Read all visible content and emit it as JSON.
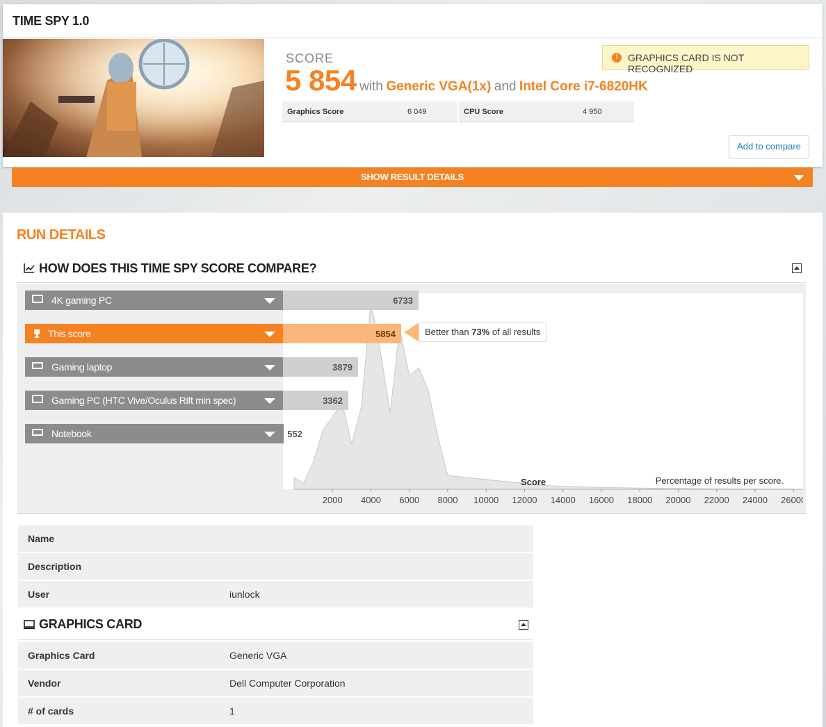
{
  "page": {
    "title": "TIME SPY 1.0"
  },
  "result": {
    "score_label": "SCORE",
    "score_value": "5 854",
    "with_text": "with",
    "gpu": "Generic VGA(1x)",
    "and_text": "and",
    "cpu": "Intel Core i7-6820HK",
    "graphics_score_label": "Graphics Score",
    "graphics_score": "6 049",
    "cpu_score_label": "CPU Score",
    "cpu_score": "4 950",
    "warning": "GRAPHICS CARD IS NOT RECOGNIZED",
    "compare_button": "Add to compare",
    "details_bar": "SHOW RESULT DETAILS"
  },
  "run_details": {
    "title": "RUN DETAILS",
    "compare_heading": "HOW DOES THIS TIME SPY SCORE COMPARE?",
    "rows": [
      {
        "label": "4K gaming PC",
        "value": "6733",
        "highlight": false,
        "icon": "desktop-icon"
      },
      {
        "label": "This score",
        "value": "5854",
        "highlight": true,
        "icon": "trophy-icon"
      },
      {
        "label": "Gaming laptop",
        "value": "3879",
        "highlight": false,
        "icon": "laptop-icon"
      },
      {
        "label": "Gaming PC (HTC Vive/Oculus Rift min spec)",
        "value": "3362",
        "highlight": false,
        "icon": "desktop-icon"
      },
      {
        "label": "Notebook",
        "value": "552",
        "highlight": false,
        "icon": "laptop-icon"
      }
    ],
    "callout_prefix": "Better than ",
    "callout_percent": "73%",
    "callout_suffix": " of all results",
    "axis_title": "Score",
    "axis_note": "Percentage of results per score."
  },
  "chart_data": {
    "type": "area",
    "xlabel": "Score",
    "x_ticks": [
      "2000",
      "4000",
      "6000",
      "8000",
      "10000",
      "12000",
      "14000",
      "16000",
      "18000",
      "20000",
      "22000",
      "24000",
      "26000"
    ],
    "xlim": [
      0,
      26500
    ],
    "x": [
      0,
      500,
      1000,
      1500,
      2000,
      2500,
      3000,
      3500,
      4000,
      4500,
      5000,
      5500,
      6000,
      6500,
      7000,
      7500,
      8000,
      9000,
      10000,
      11000,
      12000,
      13000,
      14000,
      16000,
      18000,
      20000,
      22000,
      26000
    ],
    "y": [
      6,
      3,
      14,
      30,
      37,
      44,
      23,
      42,
      96,
      70,
      39,
      82,
      58,
      62,
      50,
      26,
      7,
      6,
      5,
      4,
      3,
      2,
      1.5,
      1,
      0.6,
      0.4,
      0.2,
      0.1
    ],
    "notes": "Percentage of results per score."
  },
  "system_info": {
    "rows": [
      {
        "key": "Name",
        "value": ""
      },
      {
        "key": "Description",
        "value": ""
      },
      {
        "key": "User",
        "value": "iunlock"
      }
    ]
  },
  "graphics_card": {
    "heading": "GRAPHICS CARD",
    "rows": [
      {
        "key": "Graphics Card",
        "value": "Generic VGA"
      },
      {
        "key": "Vendor",
        "value": "Dell Computer Corporation"
      },
      {
        "key": "# of cards",
        "value": "1"
      }
    ]
  },
  "colors": {
    "accent": "#f58220",
    "warning_bg": "#fdf5c8",
    "link": "#1a7bb8"
  }
}
